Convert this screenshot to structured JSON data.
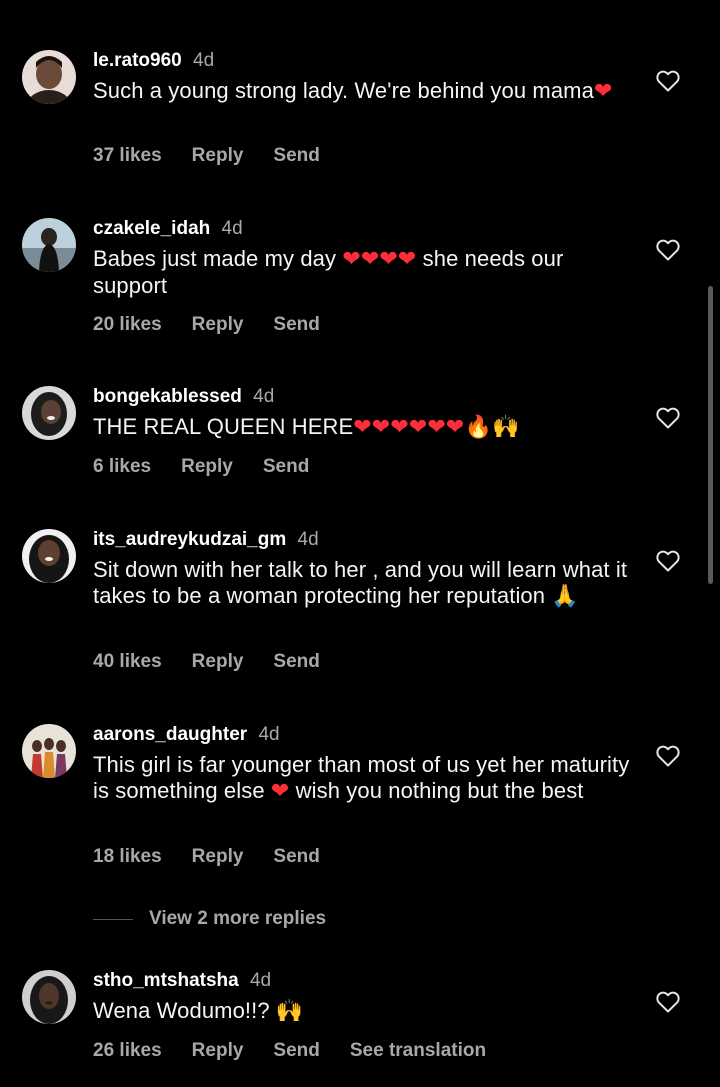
{
  "comments": [
    {
      "username": "le.rato960",
      "time": "4d",
      "text": "Such a young strong lady. We're behind you mama",
      "emoji": "❤",
      "likes": "37 likes",
      "reply": "Reply",
      "send": "Send"
    },
    {
      "username": "czakele_idah",
      "time": "4d",
      "text_a": "Babes just made my day ",
      "emoji": "❤❤❤❤",
      "text_b": "she needs our support",
      "likes": "20 likes",
      "reply": "Reply",
      "send": "Send"
    },
    {
      "username": "bongekablessed",
      "time": "4d",
      "text": "THE REAL QUEEN HERE",
      "emoji": "❤❤❤❤❤❤🔥🙌",
      "likes": "6 likes",
      "reply": "Reply",
      "send": "Send"
    },
    {
      "username": "its_audreykudzai_gm",
      "time": "4d",
      "text": "Sit down with  her talk to her , and you will learn what it takes to be a woman protecting her reputation",
      "emoji": "🙏",
      "likes": "40 likes",
      "reply": "Reply",
      "send": "Send"
    },
    {
      "username": "aarons_daughter",
      "time": "4d",
      "text_a": "This girl is far younger than most of us yet her maturity is something else ",
      "emoji": "❤",
      "text_b": "wish you nothing but the best",
      "likes": "18 likes",
      "reply": "Reply",
      "send": "Send"
    },
    {
      "username": "stho_mtshatsha",
      "time": "4d",
      "text": "Wena Wodumo!!? ",
      "emoji": "🙌",
      "likes": "26 likes",
      "reply": "Reply",
      "send": "Send",
      "translate": "See translation"
    }
  ],
  "view_more": "View 2 more replies",
  "colors": {
    "background": "#000000",
    "secondary_text": "#a8a8a8",
    "heart_emoji": "#ff2d3a"
  },
  "icons": {
    "like": "heart-outline-icon"
  }
}
